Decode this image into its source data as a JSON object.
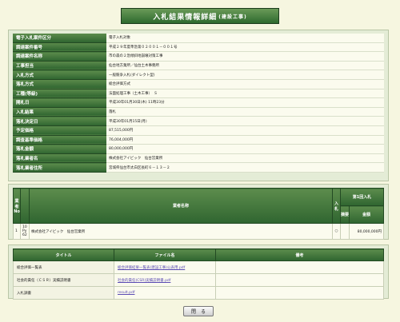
{
  "page": {
    "title": "入札結果情報詳細",
    "subtitle": "(建設工事)"
  },
  "info": [
    {
      "label": "電子入札案件区分",
      "value": "電子入札対象"
    },
    {
      "label": "調達案件番号",
      "value": "平成２９年度準急第０２００１－００１号"
    },
    {
      "label": "調達案件名称",
      "value": "市の森の２急傾斜地崩壊対策工事"
    },
    {
      "label": "工事担当",
      "value": "仙台地方業所／仙台土木事務所"
    },
    {
      "label": "入札方式",
      "value": "一般競争入札(ダイレクト型)"
    },
    {
      "label": "落札方式",
      "value": "総合評価方式"
    },
    {
      "label": "工種(等級)",
      "value": "法面処理工事（土木工事）　Ｓ"
    },
    {
      "label": "開札日",
      "value": "平成30年01月30日(木) 11時23分"
    },
    {
      "label": "入札結果",
      "value": "落札"
    },
    {
      "label": "落札決定日",
      "value": "平成30年01月15日(月)"
    },
    {
      "label": "予定価格",
      "value": "87,515,000円"
    },
    {
      "label": "調査基準価格",
      "value": "76,004,000円"
    },
    {
      "label": "落札金額",
      "value": "80,000,000円"
    },
    {
      "label": "落札業者名",
      "value": "株式会社アイビック　仙台営業所"
    },
    {
      "label": "落札業者住所",
      "value": "宮城県仙台市太白区長町６－１３－２"
    }
  ],
  "bidders": {
    "headers": {
      "no": "業者No",
      "name": "業者名称",
      "round": "入札",
      "amount_group": "第1回入札",
      "remarks": "摘要",
      "amount": "金額"
    },
    "rows": [
      {
        "no": "1",
        "code": "10 Py 62",
        "name": "株式会社アイビック　仙台営業所",
        "round": "○",
        "remarks": "",
        "amount": "80,000,000円"
      }
    ]
  },
  "documents": {
    "headers": {
      "title": "タイトル",
      "file": "ファイル名",
      "notes": "備考"
    },
    "rows": [
      {
        "title": "総合評価一覧表",
        "file": "総合評価結果一覧表(建設工事)公表用.pdf",
        "notes": ""
      },
      {
        "title": "社会的責任（ＣＳＲ）実績説明書",
        "file": "社会的責任(CSR)実績説明書.pdf",
        "notes": ""
      },
      {
        "title": "入札調書",
        "file": "result.pdf",
        "notes": ""
      }
    ]
  },
  "close_button": "閉　る"
}
